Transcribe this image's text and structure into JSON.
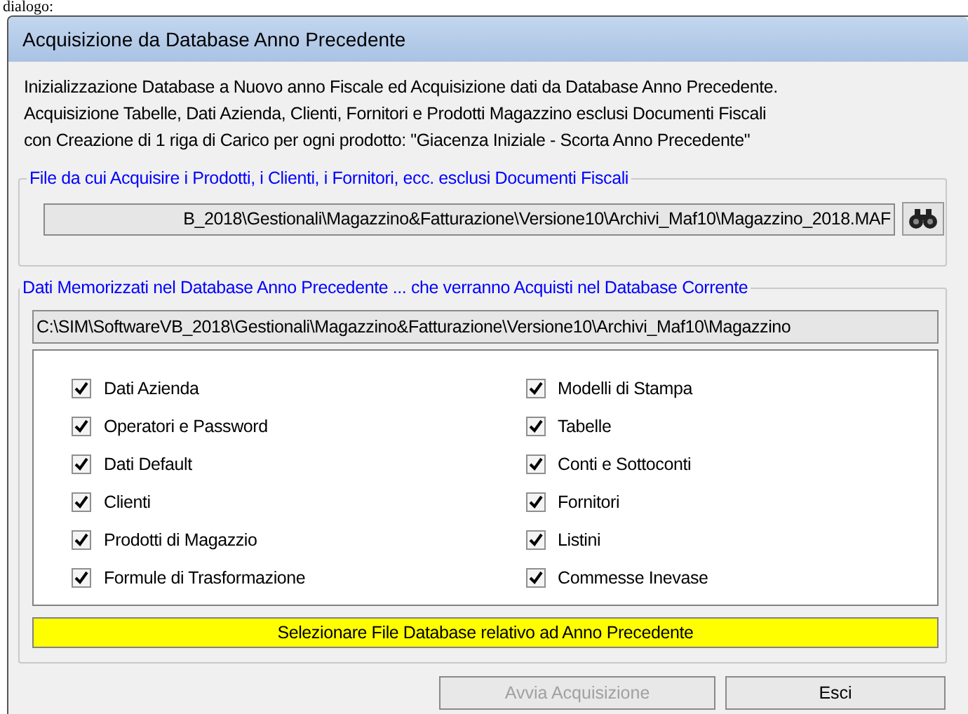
{
  "page_caption": "dialogo:",
  "window": {
    "title": "Acquisizione da Database Anno Precedente"
  },
  "intro": [
    "Inizializzazione Database a Nuovo anno Fiscale ed Acquisizione dati da Database Anno Precedente.",
    "Acquisizione Tabelle, Dati Azienda, Clienti, Fornitori e Prodotti Magazzino esclusi Documenti Fiscali",
    "con Creazione di 1 riga di Carico per ogni prodotto: \"Giacenza Iniziale - Scorta Anno Precedente\""
  ],
  "source_group": {
    "title": "File da cui Acquisire i Prodotti, i Clienti, i Fornitori, ecc. esclusi Documenti Fiscali",
    "path": "B_2018\\Gestionali\\Magazzino&Fatturazione\\Versione10\\Archivi_Maf10\\Magazzino_2018.MAF"
  },
  "data_group": {
    "title": "Dati Memorizzati nel Database Anno Precedente ... che verranno Acquisti nel Database Corrente",
    "path": "C:\\SIM\\SoftwareVB_2018\\Gestionali\\Magazzino&Fatturazione\\Versione10\\Archivi_Maf10\\Magazzino",
    "options": [
      {
        "label": "Dati Azienda",
        "checked": true
      },
      {
        "label": "Modelli di Stampa",
        "checked": true
      },
      {
        "label": "Operatori e Password",
        "checked": true
      },
      {
        "label": "Tabelle",
        "checked": true
      },
      {
        "label": "Dati Default",
        "checked": true
      },
      {
        "label": "Conti e Sottoconti",
        "checked": true
      },
      {
        "label": "Clienti",
        "checked": true
      },
      {
        "label": "Fornitori",
        "checked": true
      },
      {
        "label": "Prodotti di Magazzio",
        "checked": true
      },
      {
        "label": "Listini",
        "checked": true
      },
      {
        "label": "Formule di Trasformazione",
        "checked": true
      },
      {
        "label": "Commesse Inevase",
        "checked": true
      }
    ],
    "status": "Selezionare File Database relativo ad Anno Precedente"
  },
  "buttons": [
    {
      "label": "Avvia Acquisizione",
      "disabled": true
    },
    {
      "label": "Esci",
      "disabled": false
    }
  ]
}
